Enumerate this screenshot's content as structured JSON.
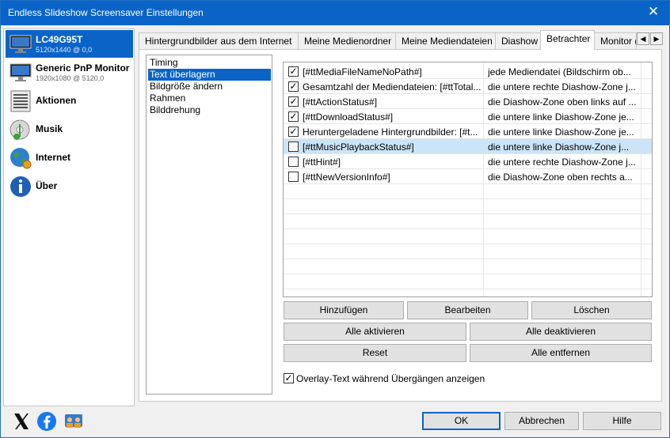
{
  "window": {
    "title": "Endless Slideshow Screensaver Einstellungen",
    "close_glyph": "✕"
  },
  "sidebar": {
    "items": [
      {
        "name": "LC49G95T",
        "sub": "5120x1440 @ 0,0",
        "icon": "monitor-icon",
        "selected": true
      },
      {
        "name": "Generic PnP Monitor",
        "sub": "1920x1080 @ 5120,0",
        "icon": "monitor-icon",
        "selected": false
      },
      {
        "name": "Aktionen",
        "icon": "actions-list-icon"
      },
      {
        "name": "Musik",
        "icon": "music-icon"
      },
      {
        "name": "Internet",
        "icon": "globe-icon"
      },
      {
        "name": "Über",
        "icon": "info-icon"
      }
    ]
  },
  "tabs": [
    {
      "label": "Hintergrundbilder aus dem Internet"
    },
    {
      "label": "Meine Medienordner"
    },
    {
      "label": "Meine Mediendateien"
    },
    {
      "label": "Diashow"
    },
    {
      "label": "Betrachter",
      "active": true
    },
    {
      "label": "Monitor ("
    }
  ],
  "tab_scroll": {
    "left": "◀",
    "right": "▶"
  },
  "categories": [
    {
      "label": "Timing"
    },
    {
      "label": "Text überlagern",
      "selected": true
    },
    {
      "label": "Bildgröße ändern"
    },
    {
      "label": "Rahmen"
    },
    {
      "label": "Bilddrehung"
    }
  ],
  "overlay_rows": [
    {
      "checked": true,
      "text": "[#ttMediaFileNameNoPath#]",
      "zone": "jede Mediendatei (Bildschirm ob..."
    },
    {
      "checked": true,
      "text": "Gesamtzahl der Mediendateien: [#ttTotal...",
      "zone": "die untere rechte Diashow-Zone j..."
    },
    {
      "checked": true,
      "text": "[#ttActionStatus#]",
      "zone": "die Diashow-Zone oben links auf ..."
    },
    {
      "checked": true,
      "text": "[#ttDownloadStatus#]",
      "zone": "die untere linke Diashow-Zone je..."
    },
    {
      "checked": true,
      "text": "Heruntergeladene Hintergrundbilder: [#t...",
      "zone": "die untere linke Diashow-Zone je..."
    },
    {
      "checked": false,
      "text": "[#ttMusicPlaybackStatus#]",
      "zone": "die untere linke Diashow-Zone j...",
      "highlighted": true
    },
    {
      "checked": false,
      "text": "[#ttHint#]",
      "zone": "die untere rechte Diashow-Zone j..."
    },
    {
      "checked": false,
      "text": "[#ttNewVersionInfo#]",
      "zone": "die Diashow-Zone oben rechts a..."
    }
  ],
  "buttons": {
    "add": "Hinzufügen",
    "edit": "Bearbeiten",
    "delete": "Löschen",
    "enable_all": "Alle aktivieren",
    "disable_all": "Alle deaktivieren",
    "reset": "Reset",
    "remove_all": "Alle entfernen"
  },
  "overlay_during_transitions": {
    "checked": true,
    "label": "Overlay-Text während Übergängen anzeigen"
  },
  "check_glyph": "✓",
  "footer": {
    "social_icons": [
      "x-icon",
      "facebook-icon",
      "community-icon"
    ],
    "ok": "OK",
    "cancel": "Abbrechen",
    "help": "Hilfe"
  },
  "colors": {
    "accent": "#0a64c8",
    "row_highlight": "#cce4f7"
  }
}
